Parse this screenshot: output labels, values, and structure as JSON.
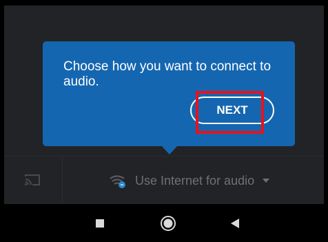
{
  "tooltip": {
    "message": "Choose how you want to connect to audio.",
    "next_label": "NEXT"
  },
  "audio_option": {
    "label": "Use Internet for audio",
    "icon": "wifi-audio-icon"
  },
  "cast": {
    "icon": "cast-icon"
  },
  "nav": {
    "recents_icon": "square-icon",
    "home_icon": "circle-icon",
    "back_icon": "triangle-back-icon"
  },
  "colors": {
    "tooltip_bg": "#1566b0",
    "app_bg": "#222326",
    "highlight": "#e8121c",
    "muted_text": "#6f7076"
  }
}
